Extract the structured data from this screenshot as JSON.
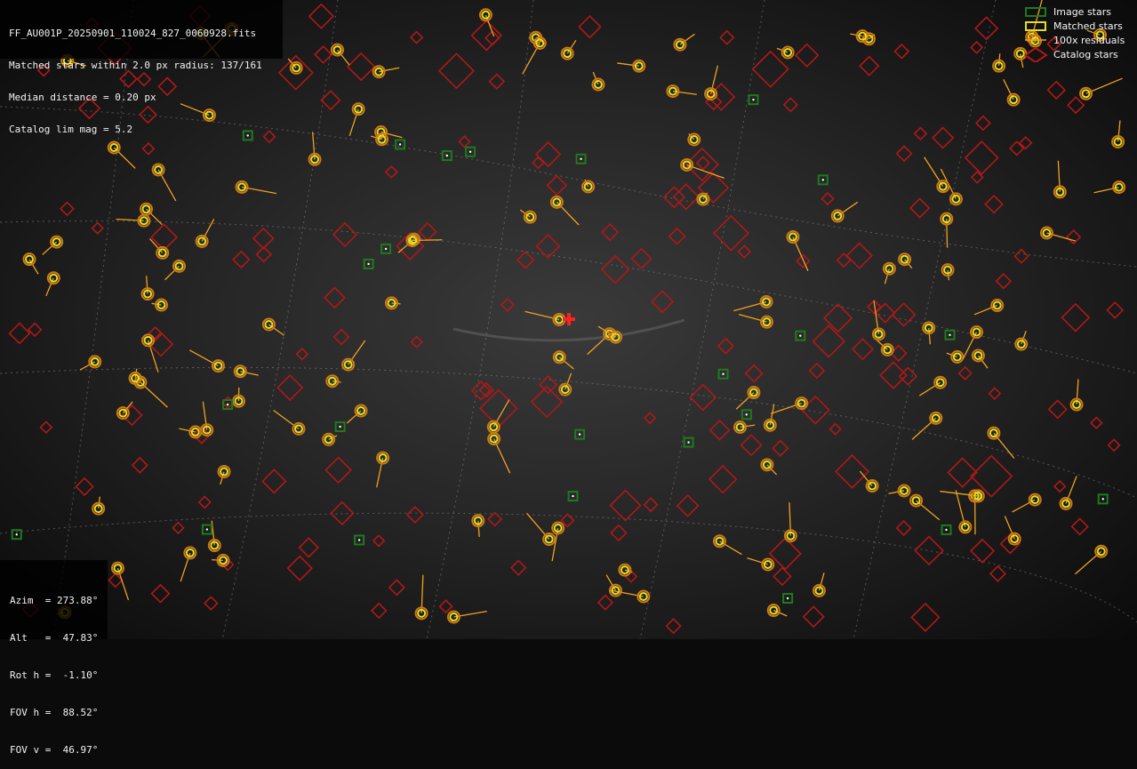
{
  "header": {
    "filename": "FF_AU001P_20250901_110024_827_0060928.fits",
    "matched": "Matched stars within 2.0 px radius: 137/161",
    "median": "Median distance = 0.20 px",
    "catalog_lim": "Catalog lim mag = 5.2"
  },
  "legend": {
    "image_stars": "Image stars",
    "matched_stars": "Matched stars",
    "residuals": "100x residuals",
    "catalog_stars": "Catalog stars"
  },
  "pointing": {
    "azim": "Azim  = 273.88°",
    "alt": "Alt   =  47.83°",
    "rot": "Rot h =  -1.10°",
    "fov_h": "FOV h =  88.52°",
    "fov_v": "FOV v =  46.97°"
  },
  "colors": {
    "image_star": "#1e7a1e",
    "matched_inner": "#e0e020",
    "matched_outer": "#d07818",
    "residual": "#f0a020",
    "catalog": "#b01818",
    "center": "#ff2020",
    "grid": "#8a8a8a"
  },
  "icons": {
    "center": "red-cross-icon"
  }
}
